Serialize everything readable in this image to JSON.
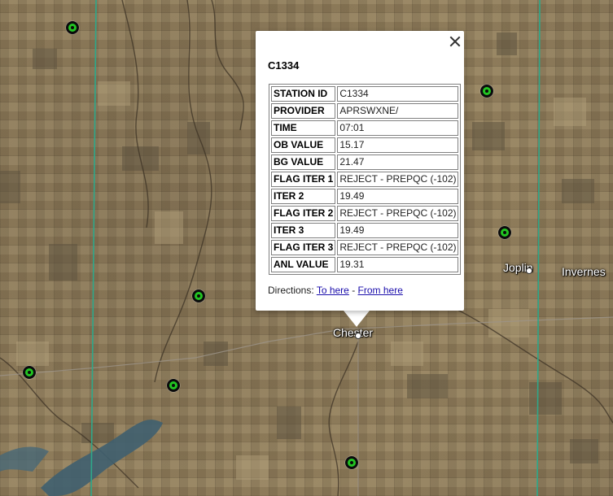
{
  "map": {
    "places": [
      "Joplin",
      "Invernes",
      "Chester"
    ],
    "colors": {
      "county_line": "#2ea88a",
      "station_marker": "#22c422",
      "water": "#3f5f6f"
    }
  },
  "popup": {
    "title": "C1334",
    "rows": [
      {
        "key": "STATION ID",
        "value": "C1334"
      },
      {
        "key": "PROVIDER",
        "value": "APRSWXNE/"
      },
      {
        "key": "TIME",
        "value": "07:01"
      },
      {
        "key": "OB VALUE",
        "value": "15.17"
      },
      {
        "key": "BG VALUE",
        "value": "21.47"
      },
      {
        "key": "FLAG ITER 1",
        "value": "REJECT - PREPQC (-102)"
      },
      {
        "key": "ITER 2",
        "value": "19.49"
      },
      {
        "key": "FLAG ITER 2",
        "value": "REJECT - PREPQC (-102)"
      },
      {
        "key": "ITER 3",
        "value": "19.49"
      },
      {
        "key": "FLAG ITER 3",
        "value": "REJECT - PREPQC (-102)"
      },
      {
        "key": "ANL VALUE",
        "value": "19.31"
      }
    ],
    "directions": {
      "prefix": "Directions:",
      "to_here": "To here",
      "separator": "-",
      "from_here": "From here"
    },
    "close_icon": "close-icon"
  }
}
